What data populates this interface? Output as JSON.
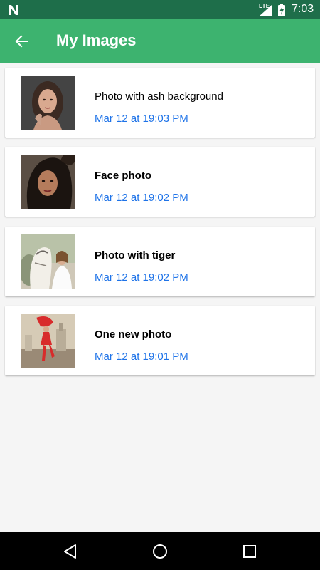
{
  "status_bar": {
    "network": "LTE",
    "time": "7:03",
    "icons": [
      "n-notification-icon",
      "signal-icon",
      "battery-charging-icon"
    ]
  },
  "app_bar": {
    "title": "My Images",
    "back_icon": "arrow-back-icon"
  },
  "images": [
    {
      "title": "Photo with ash background",
      "date": "Mar 12 at 19:03 PM",
      "thumbnail": "woman-portrait-dark-background"
    },
    {
      "title": "Face photo",
      "date": "Mar 12 at 19:02 PM",
      "thumbnail": "woman-face-dark-hair"
    },
    {
      "title": "Photo with tiger",
      "date": "Mar 12 at 19:02 PM",
      "thumbnail": "woman-with-white-tiger"
    },
    {
      "title": "One new photo",
      "date": "Mar 12 at 19:01 PM",
      "thumbnail": "woman-red-dress-jumping"
    }
  ],
  "nav_bar": {
    "buttons": [
      "back-triangle-icon",
      "home-circle-icon",
      "recents-square-icon"
    ]
  },
  "colors": {
    "status_bar": "#1e6e4a",
    "app_bar": "#3db36f",
    "date_text": "#1e73e8",
    "background": "#f5f5f5"
  }
}
